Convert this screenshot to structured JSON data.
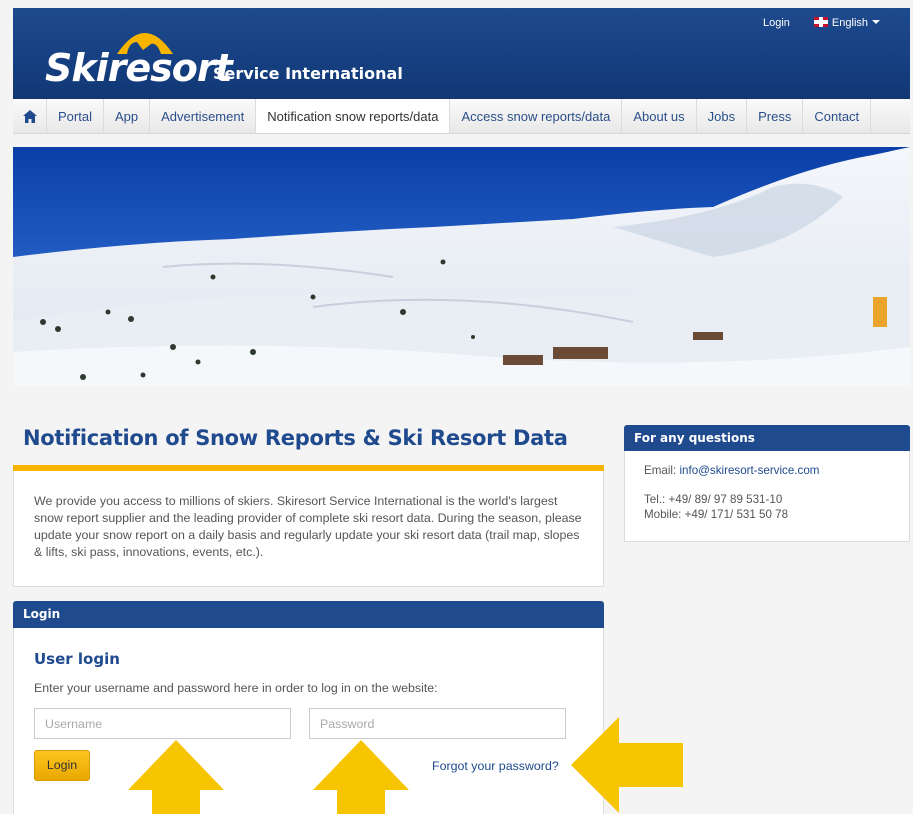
{
  "header": {
    "logo_main": "Skiresort",
    "logo_sub": "Service International",
    "login_link": "Login",
    "language": "English"
  },
  "nav": {
    "home_icon": "home-icon",
    "items": [
      "Portal",
      "App",
      "Advertisement",
      "Notification snow reports/data",
      "Access snow reports/data",
      "About us",
      "Jobs",
      "Press",
      "Contact"
    ],
    "active": "Notification snow reports/data"
  },
  "main": {
    "title": "Notification of Snow Reports & Ski Resort Data",
    "intro": "We provide you access to millions of skiers. Skiresort Service International is the world's largest snow report supplier and the leading provider of complete ski resort data. During the season, please update your snow report on a daily basis and regularly update your ski resort data (trail map, slopes & lifts, ski pass, innovations, events, etc.)."
  },
  "login": {
    "panel_title": "Login",
    "heading": "User login",
    "description": "Enter your username and password here in order to log in on the website:",
    "username_placeholder": "Username",
    "password_placeholder": "Password",
    "button_label": "Login",
    "forgot_label": "Forgot your password?"
  },
  "sidebar": {
    "title": "For any questions",
    "email_label": "Email:",
    "email": "info@skiresort-service.com",
    "tel": "Tel.: +49/ 89/ 97 89 531-10",
    "mobile": "Mobile: +49/ 171/ 531 50 78"
  },
  "colors": {
    "brand_blue": "#1f4a8e",
    "accent_yellow": "#f7b500"
  }
}
